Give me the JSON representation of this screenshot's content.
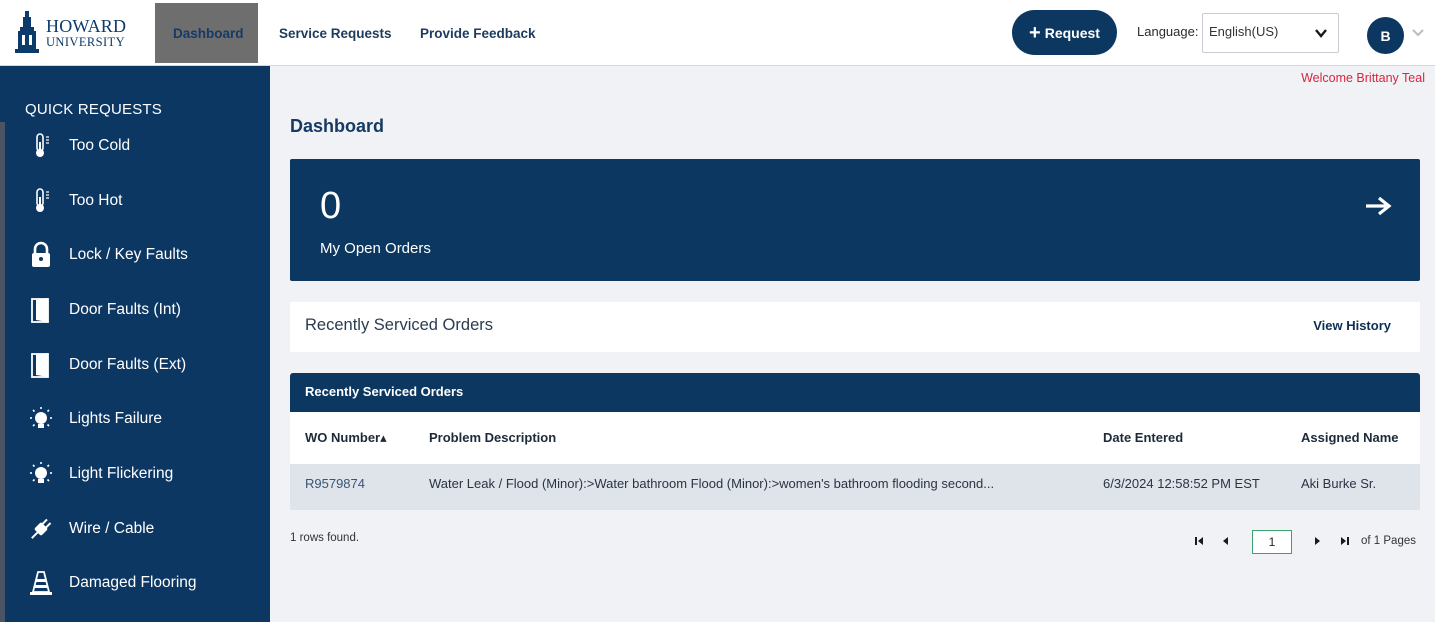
{
  "header": {
    "logo_line1": "HOWARD",
    "logo_line2": "UNIVERSITY",
    "nav": [
      {
        "label": "Dashboard",
        "active": true
      },
      {
        "label": "Service Requests",
        "active": false
      },
      {
        "label": "Provide Feedback",
        "active": false
      }
    ],
    "request_button": "Request",
    "language_label": "Language:",
    "language_value": "English(US)",
    "avatar_initial": "B"
  },
  "welcome": "Welcome Brittany Teal",
  "sidebar": {
    "title": "QUICK REQUESTS",
    "items": [
      {
        "label": "Too Cold",
        "icon": "thermometer-icon"
      },
      {
        "label": "Too Hot",
        "icon": "thermometer-icon"
      },
      {
        "label": "Lock / Key Faults",
        "icon": "lock-icon"
      },
      {
        "label": "Door Faults (Int)",
        "icon": "door-icon"
      },
      {
        "label": "Door Faults (Ext)",
        "icon": "door-icon"
      },
      {
        "label": "Lights Failure",
        "icon": "lightbulb-icon"
      },
      {
        "label": "Light Flickering",
        "icon": "lightbulb-icon"
      },
      {
        "label": "Wire / Cable",
        "icon": "plug-icon"
      },
      {
        "label": "Damaged Flooring",
        "icon": "cone-icon"
      }
    ]
  },
  "main": {
    "title": "Dashboard",
    "open_orders": {
      "count": "0",
      "label": "My Open Orders"
    },
    "recent": {
      "title": "Recently Serviced Orders",
      "view_history": "View History"
    },
    "grid": {
      "title": "Recently Serviced Orders",
      "columns": [
        "WO Number▴",
        "Problem Description",
        "Date Entered",
        "Assigned Name"
      ],
      "rows": [
        {
          "wo": "R9579874",
          "description": "Water Leak / Flood (Minor):>Water bathroom Flood (Minor):>women's bathroom flooding second...",
          "date": "6/3/2024 12:58:52 PM EST",
          "assigned": "Aki Burke Sr."
        }
      ]
    },
    "rows_found": "1 rows found.",
    "pager": {
      "page": "1",
      "of_label": "of 1 Pages"
    }
  },
  "colors": {
    "navy": "#0b3761",
    "welcome_red": "#d9263c"
  }
}
